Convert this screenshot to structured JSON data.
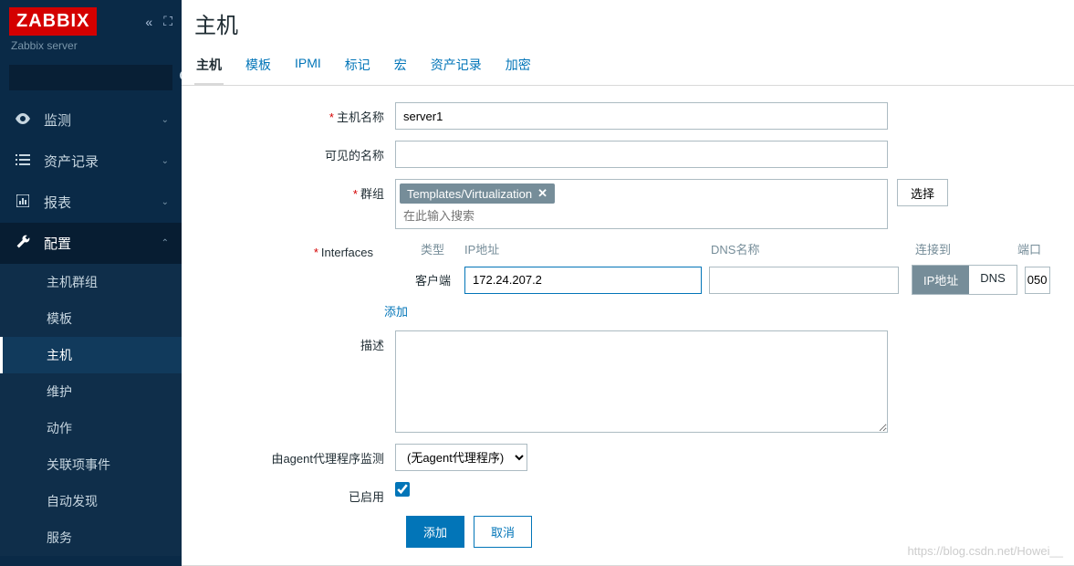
{
  "sidebar": {
    "logo": "ZABBIX",
    "server": "Zabbix server",
    "nav": {
      "monitoring": "监测",
      "inventory": "资产记录",
      "reports": "报表",
      "config": "配置"
    },
    "config_sub": {
      "hostgroups": "主机群组",
      "templates": "模板",
      "hosts": "主机",
      "maintenance": "维护",
      "actions": "动作",
      "correlation": "关联项事件",
      "discovery": "自动发现",
      "services": "服务"
    }
  },
  "page": {
    "title": "主机",
    "tabs": {
      "host": "主机",
      "templates": "模板",
      "ipmi": "IPMI",
      "tags": "标记",
      "macros": "宏",
      "inventory": "资产记录",
      "encryption": "加密"
    }
  },
  "form": {
    "labels": {
      "hostname": "主机名称",
      "visiblename": "可见的名称",
      "groups": "群组",
      "interfaces": "Interfaces",
      "description": "描述",
      "proxy": "由agent代理程序监测",
      "enabled": "已启用"
    },
    "values": {
      "hostname": "server1",
      "visiblename": "",
      "group_tag": "Templates/Virtualization",
      "group_placeholder": "在此输入搜索",
      "ip": "172.24.207.2",
      "dns": "",
      "port": "050",
      "description": "",
      "proxy": "(无agent代理程序)",
      "enabled": true
    },
    "groups_select": "选择",
    "iface_headers": {
      "type": "类型",
      "ip": "IP地址",
      "dns": "DNS名称",
      "connect": "连接到",
      "port": "端口"
    },
    "iface_type": "客户端",
    "toggle": {
      "ip": "IP地址",
      "dns": "DNS"
    },
    "add_link": "添加",
    "buttons": {
      "add": "添加",
      "cancel": "取消"
    }
  },
  "watermark": "https://blog.csdn.net/Howei__"
}
